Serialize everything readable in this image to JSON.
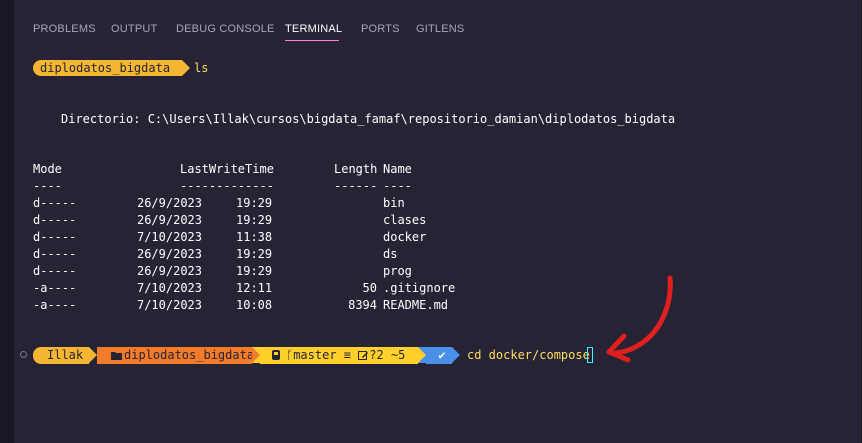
{
  "tabs": [
    {
      "label": "PROBLEMS",
      "active": false
    },
    {
      "label": "OUTPUT",
      "active": false
    },
    {
      "label": "DEBUG CONSOLE",
      "active": false
    },
    {
      "label": "TERMINAL",
      "active": true
    },
    {
      "label": "PORTS",
      "active": false
    },
    {
      "label": "GITLENS",
      "active": false
    }
  ],
  "prompt1": {
    "dir": "diplodatos_bigdata",
    "command": "ls"
  },
  "listing": {
    "directory_line": "Directorio: C:\\Users\\Illak\\cursos\\bigdata_famaf\\repositorio_damian\\diplodatos_bigdata",
    "headers": {
      "mode": "Mode",
      "lastwrite": "LastWriteTime",
      "length": "Length",
      "name": "Name"
    },
    "underline": {
      "mode": "----",
      "lastwrite": "-------------",
      "length": "------",
      "name": "----"
    },
    "rows": [
      {
        "mode": "d-----",
        "date": "26/9/2023",
        "time": "19:29",
        "length": "",
        "name": "bin"
      },
      {
        "mode": "d-----",
        "date": "26/9/2023",
        "time": "19:29",
        "length": "",
        "name": "clases"
      },
      {
        "mode": "d-----",
        "date": "7/10/2023",
        "time": "11:38",
        "length": "",
        "name": "docker"
      },
      {
        "mode": "d-----",
        "date": "26/9/2023",
        "time": "19:29",
        "length": "",
        "name": "ds"
      },
      {
        "mode": "d-----",
        "date": "26/9/2023",
        "time": "19:29",
        "length": "",
        "name": "prog"
      },
      {
        "mode": "-a----",
        "date": "7/10/2023",
        "time": "12:11",
        "length": "50",
        "name": ".gitignore"
      },
      {
        "mode": "-a----",
        "date": "7/10/2023",
        "time": "10:08",
        "length": "8394",
        "name": "README.md"
      }
    ]
  },
  "prompt2": {
    "user": "Illak",
    "dir": "diplodatos_bigdata",
    "branch": "master",
    "branch_status": "≡",
    "changes": "?2 ~5",
    "status_glyph": "✔",
    "command": "cd docker/compose"
  },
  "colors": {
    "background": "#262335",
    "accent_tab": "#ff7edb",
    "prompt_yellow": "#f5b731",
    "prompt_orange": "#f37b2a",
    "git_yellow": "#ffd02a",
    "status_blue": "#4a8fe8",
    "cursor": "#36f9f6",
    "annotation_arrow": "#e02020"
  }
}
